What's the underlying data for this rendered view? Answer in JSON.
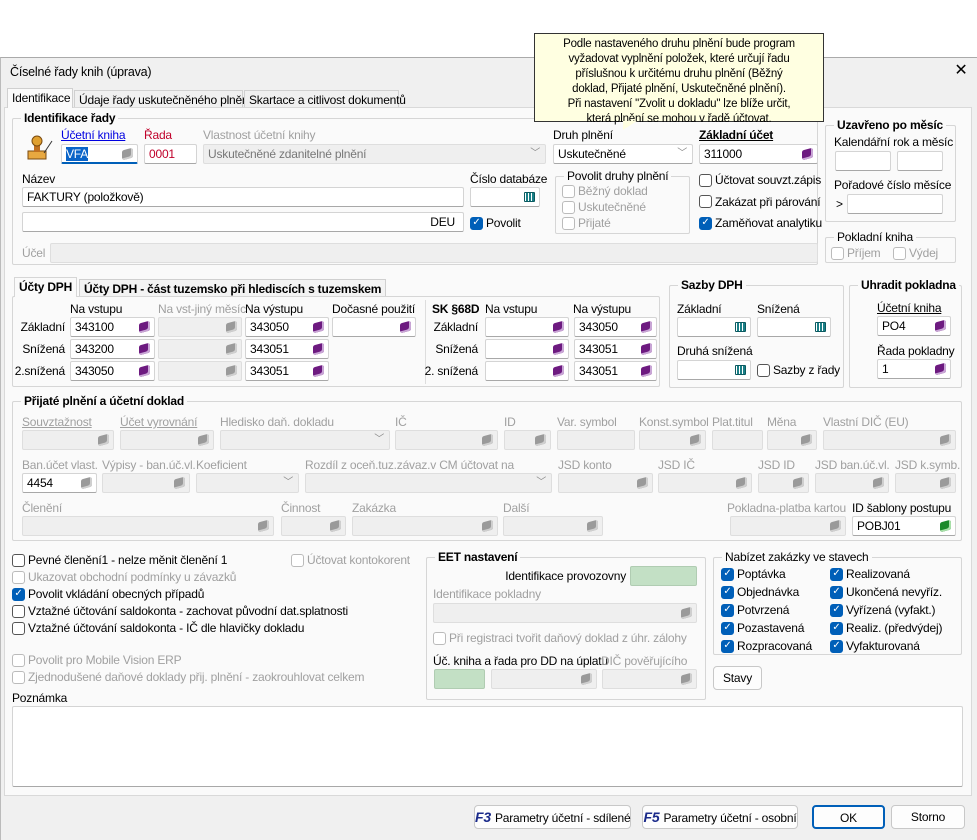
{
  "window": {
    "title": "Číselné řady knih (úprava)",
    "close_icon": "close-icon"
  },
  "tooltip": {
    "lines": [
      "Podle nastaveného druhu plnění bude program",
      "vyžadovat vyplnění položek, které určují řadu",
      "příslušnou k určitému druhu plnění (Běžný",
      "doklad, Přijaté plnění, Uskutečněné plnění).",
      "Při nastavení \"Zvolit u dokladu\" lze blíže určit,",
      "která plnění se mohou v řadě účtovat."
    ]
  },
  "tabs": [
    {
      "label": "Identifikace",
      "active": true
    },
    {
      "label": "Údaje řady uskutečněného plnění"
    },
    {
      "label": "Skartace a citlivost dokumentů"
    }
  ],
  "ident": {
    "title": "Identifikace řady",
    "kniha_label": "Účetní kniha",
    "kniha_value": "VFA",
    "rada_label": "Řada",
    "rada_value": "0001",
    "vlastnost_label": "Vlastnost účetní knihy",
    "vlastnost_value": "Uskutečněné zdanitelné plnění",
    "nazev_label": "Název",
    "nazev_value": "FAKTURY (položkově)",
    "nazev2_value": "DEU",
    "cislo_db_label": "Číslo databáze",
    "povolit_label": "Povolit",
    "povolit_checked": true,
    "ucel_label": "Účel",
    "druh_label": "Druh plnění",
    "druh_value": "Uskutečněné",
    "povolit_druhy": {
      "title": "Povolit druhy plnění",
      "items": [
        "Běžný doklad",
        "Uskutečněné",
        "Přijaté"
      ]
    },
    "zakladni_ucet_label": "Základní účet",
    "zakladni_ucet_value": "311000",
    "checks": [
      {
        "label": "Účtovat souvzt.zápis",
        "checked": false
      },
      {
        "label": "Zakázat při párování",
        "checked": false
      },
      {
        "label": "Zaměňovat analytiku",
        "checked": true
      }
    ],
    "uzavreno": {
      "title": "Uzavřeno po měsíc",
      "kal_label": "Kalendářní rok a měsíc",
      "por_label": "Pořadové číslo měsíce",
      "gt": ">"
    },
    "pokladni": {
      "title": "Pokladní kniha",
      "items": [
        "Příjem",
        "Výdej"
      ]
    }
  },
  "dph": {
    "tabs": [
      "Účty DPH",
      "Účty DPH - část tuzemsko při hlediscích s tuzemskem"
    ],
    "headers": [
      "Na vstupu",
      "Na vst-jiný měsíc",
      "Na výstupu",
      "Dočasné použití"
    ],
    "rows": [
      {
        "label": "Základní",
        "vstup": "343100",
        "vystup": "343050"
      },
      {
        "label": "Snížená",
        "vstup": "343200",
        "vystup": "343051"
      },
      {
        "label": "2.snížená",
        "vstup": "343050",
        "vystup": "343051"
      }
    ],
    "sk_title": "SK §68D",
    "sk_headers": [
      "Na vstupu",
      "Na výstupu"
    ],
    "sk_rows": [
      {
        "label": "Základní",
        "vystup": "343050"
      },
      {
        "label": "Snížená",
        "vystup": "343051"
      },
      {
        "label": "2. snížená",
        "vystup": "343051"
      }
    ]
  },
  "sazby": {
    "title": "Sazby DPH",
    "zakladni": "Základní",
    "snizena": "Snížená",
    "druha": "Druhá snížená",
    "z_rady": "Sazby z řady"
  },
  "uhradit": {
    "title": "Uhradit pokladna",
    "kniha_label": "Účetní kniha",
    "kniha_value": "PO4",
    "rada_label": "Řada pokladny",
    "rada_value": "1"
  },
  "prijate": {
    "title": "Přijaté plnění a účetní doklad",
    "row1": [
      "Souvztažnost",
      "Účet vyrovnání",
      "Hledisko daň. dokladu",
      "IČ",
      "ID",
      "Var. symbol",
      "Konst.symbol",
      "Plat.titul",
      "Měna",
      "Vlastní DIČ (EU)"
    ],
    "row2": [
      "Ban.účet vlast.",
      "Výpisy - ban.úč.vl.",
      "Koeficient",
      "Rozdíl z oceň.tuz.závaz.v CM účtovat na",
      "JSD konto",
      "JSD IČ",
      "JSD ID",
      "JSD ban.úč.vl.",
      "JSD k.symb."
    ],
    "ban_ucet_value": "4454",
    "row3": [
      "Členění",
      "Činnost",
      "Zakázka",
      "Další",
      "Pokladna-platba kartou",
      "ID šablony postupu"
    ],
    "sablona_value": "POBJ01"
  },
  "options": [
    {
      "label": "Pevné členění1 - nelze měnit členění 1",
      "checked": false,
      "disabled": false
    },
    {
      "label": "Ukazovat obchodní podmínky u závazků",
      "checked": false,
      "disabled": true
    },
    {
      "label": "Povolit vkládání obecných případů",
      "checked": true,
      "disabled": false
    },
    {
      "label": "Vztažné účtování saldokonta - zachovat původní dat.splatnosti",
      "checked": false,
      "disabled": false
    },
    {
      "label": "Vztažné účtování saldokonta - IČ dle hlavičky dokladu",
      "checked": false,
      "disabled": false
    },
    {
      "label": "Povolit pro Mobile Vision ERP",
      "checked": false,
      "disabled": true
    },
    {
      "label": "Zjednodušené daňové doklady přij. plnění - zaokrouhlovat celkem",
      "checked": false,
      "disabled": true
    }
  ],
  "kontokorent": "Účtovat kontokorent",
  "eet": {
    "title": "EET nastavení",
    "provozovna": "Identifikace provozovny",
    "pokladna": "Identifikace pokladny",
    "registrace": "Při registraci tvořit daňový doklad z úhr. zálohy",
    "kniha_dd": "Úč. kniha a řada pro DD na úplatu",
    "dic": "DIČ pověřujícího"
  },
  "zakazky": {
    "title": "Nabízet zakázky ve stavech",
    "col1": [
      "Poptávka",
      "Objednávka",
      "Potvrzená",
      "Pozastavená",
      "Rozpracovaná"
    ],
    "col2": [
      "Realizovaná",
      "Ukončená nevyříz.",
      "Vyřízená (vyfakt.)",
      "Realiz. (předvýdej)",
      "Vyfakturovaná"
    ],
    "stavy": "Stavy"
  },
  "poznamka": "Poznámka",
  "buttons": {
    "f3_key": "F3",
    "f3": "Parametry účetní - sdílené",
    "f5_key": "F5",
    "f5": "Parametry účetní - osobní",
    "ok": "OK",
    "storno": "Storno"
  },
  "colors": {
    "accent": "#005fb8",
    "link": "#0000e0",
    "rada": "#c0002a",
    "green_field": "#c3e0c5",
    "tooltip": "#ffffe1"
  }
}
